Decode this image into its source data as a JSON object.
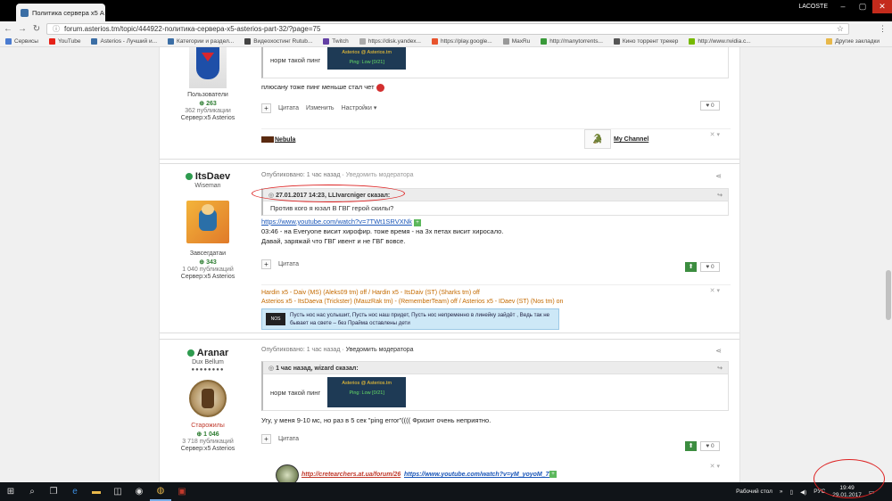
{
  "browser": {
    "tab_title": "Политика сервера x5 А",
    "user_label": "LACOSTE",
    "url": "forum.asterios.tm/topic/444922-политика-сервера-x5-asterios-part-32/?page=75",
    "bookmarks": [
      "Сервисы",
      "YouTube",
      "Asterios - Лучший и...",
      "Категории и раздел...",
      "Видеохостинг Rutub...",
      "Twitch",
      "https://disk.yandex...",
      "https://play.google...",
      "MaxRu",
      "http://manytorrents...",
      "Кино торрент трекер",
      "http://www.nvidia.c...",
      "Другие закладки"
    ],
    "accent": "#1a56b8"
  },
  "post0": {
    "group": "Пользователи",
    "rep": "263",
    "pubs": "362 публикации",
    "server": "Сервер:x5 Asterios",
    "quote_text": "норм такой пинг",
    "ping_line1": "Asterios @ Asterios.tm",
    "ping_line2": "Ping: Low [0/21]",
    "text": "плюсану тоже пинг меньше стал чет",
    "quote_label": "Цитата",
    "edit_label": "Изменить",
    "settings_label": "Настройки",
    "like_count": "0",
    "sig_left": "Nebula",
    "sig_right": "My Channel"
  },
  "post1": {
    "name": "ItsDaev",
    "title": "Wiseman",
    "group": "Завсегдатаи",
    "rep": "343",
    "pubs": "1 040 публикаций",
    "server": "Сервер:x5 Asterios",
    "published": "Опубликовано: 1 час назад",
    "notify": "Уведомить модератора",
    "quote_header": "27.01.2017 14:23, LLIvarcniger сказал:",
    "quote_text": "Против кого я юзал В ГВГ герой скилы?",
    "link": "https://www.youtube.com/watch?v=7TWt1SRVXNk",
    "line1": "03:46 - на Everyone висит хирофир. тоже время - на 3х петах висит хиросало.",
    "line2": "Давай, заряжай что ГВГ ивент и не ГВГ вовсе.",
    "quote_label": "Цитата",
    "like_count": "0",
    "sig_line1": "Hardin x5 - Daiv (MS) (Aleks09 tm) off / Hardin x5 - ItsDaiv (ST) (Sharks tm) off",
    "sig_line2": "Asterios x5 - ItsDaeva (Trickster) (MauzRak tm) - (RememberTeam) off / Asterios x5 - IDaev (ST) (Nos tm) on",
    "sig_quote": "Пусть нос нас услышит, Пусть нос наш придет, Пусть нос непременно в линейку зайдёт , Ведь так не бывает на свете – без Прайма оставлены дети"
  },
  "post2": {
    "name": "Aranar",
    "title": "Dux Bellum",
    "group": "Старожилы",
    "rep": "1 046",
    "pubs": "3 718 публикаций",
    "server": "Сервер:x5 Asterios",
    "published": "Опубликовано: 1 час назад",
    "notify": "Уведомить модератора",
    "quote_header": "1 час назад, wizard сказал:",
    "quote_text": "норм такой пинг",
    "ping_line1": "Asterios @ Asterios.tm",
    "ping_line2": "Ping: Low [0/21]",
    "text": "Угу, у меня 9-10 мс, но раз в 5 сек \"ping error\"(((( Фризит очень неприятно.",
    "quote_label": "Цитата",
    "like_count": "0",
    "sig_link1": "http://cretearchers.at.ua/forum/26",
    "sig_link2": "https://www.youtube.com/watch?v=yM_yoyoM_7A"
  },
  "taskbar": {
    "desktop_label": "Рабочий стол",
    "lang": "РУС",
    "time": "19:49",
    "date": "29.01.2017"
  }
}
